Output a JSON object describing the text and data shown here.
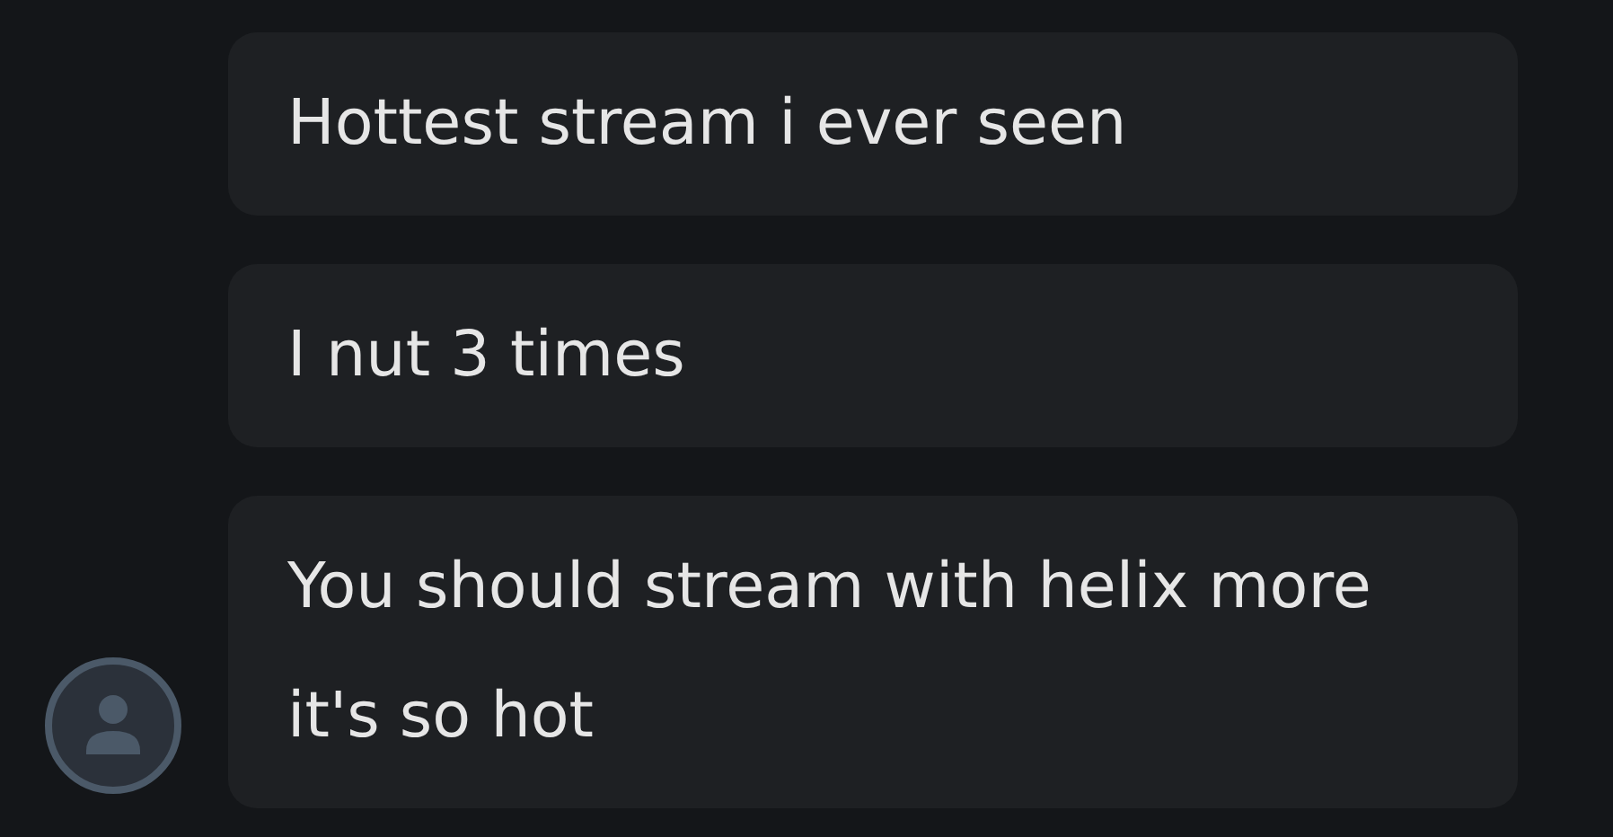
{
  "messages": [
    {
      "text": "Hottest stream i ever seen"
    },
    {
      "text": "I nut 3 times"
    },
    {
      "text": "You should stream with helix more it's so hot"
    }
  ]
}
